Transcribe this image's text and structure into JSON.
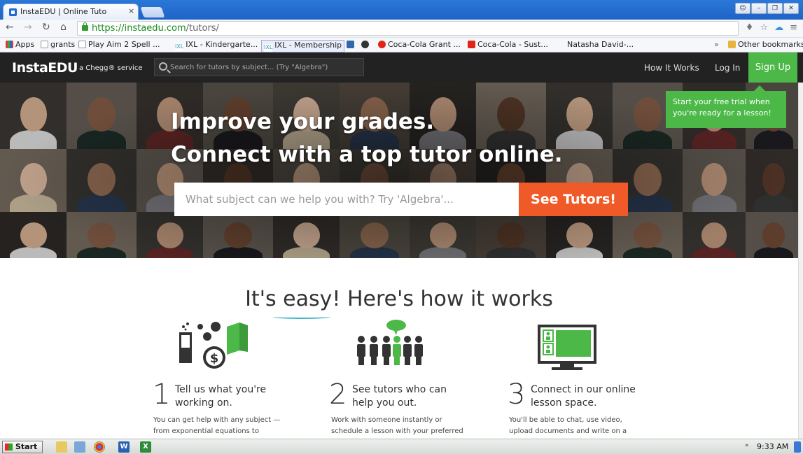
{
  "browser": {
    "tab_title": "InstaEDU | Online Tuto",
    "tab_close": "×",
    "url_host": "https://instaedu.com",
    "url_path": "/tutors/",
    "bookmarks": [
      "Apps",
      "grants",
      "Play Aim 2 Spell ...",
      "IXL - Kindergarte...",
      "IXL - Membership",
      "Coca-Cola Grant ...",
      "Coca-Cola - Sust...",
      "Natasha David-..."
    ],
    "other_bookmarks": "Other bookmarks",
    "more_chevron": "»"
  },
  "site": {
    "logo": "InstaEDU",
    "logo_sub": "a Chegg® service",
    "search_placeholder": "Search for tutors by subject... (Try \"Algebra\")",
    "nav": {
      "how_it_works": "How It Works",
      "log_in": "Log In",
      "sign_up": "Sign Up"
    },
    "tooltip_line1": "Start your free trial when",
    "tooltip_line2": "you're ready for a lesson!"
  },
  "hero": {
    "headline1": "Improve your grades.",
    "headline2": "Connect with a top tutor online.",
    "input_placeholder": "What subject can we help you with? Try 'Algebra'...",
    "button": "See Tutors!"
  },
  "how": {
    "title_pre": "It's ",
    "title_em": "easy",
    "title_post": "! Here's how it works",
    "steps": [
      {
        "num": "1",
        "head1": "Tell us what you're",
        "head2": "working on.",
        "text1": "You can get help with any subject —",
        "text2": "from exponential equations to"
      },
      {
        "num": "2",
        "head1": "See tutors who can",
        "head2": "help you out.",
        "text1": "Work with someone instantly or",
        "text2": "schedule a lesson with your preferred"
      },
      {
        "num": "3",
        "head1": "Connect in our online",
        "head2": "lesson space.",
        "text1": "You'll be able to chat, use video,",
        "text2": "upload documents and write on a"
      }
    ]
  },
  "taskbar": {
    "start": "Start",
    "clock": "9:33 AM",
    "tray_arrow": "»"
  },
  "colors": {
    "green": "#4cb848",
    "orange": "#f05a28",
    "header_bg": "#222222",
    "teal_accent": "#3bb3c3"
  }
}
